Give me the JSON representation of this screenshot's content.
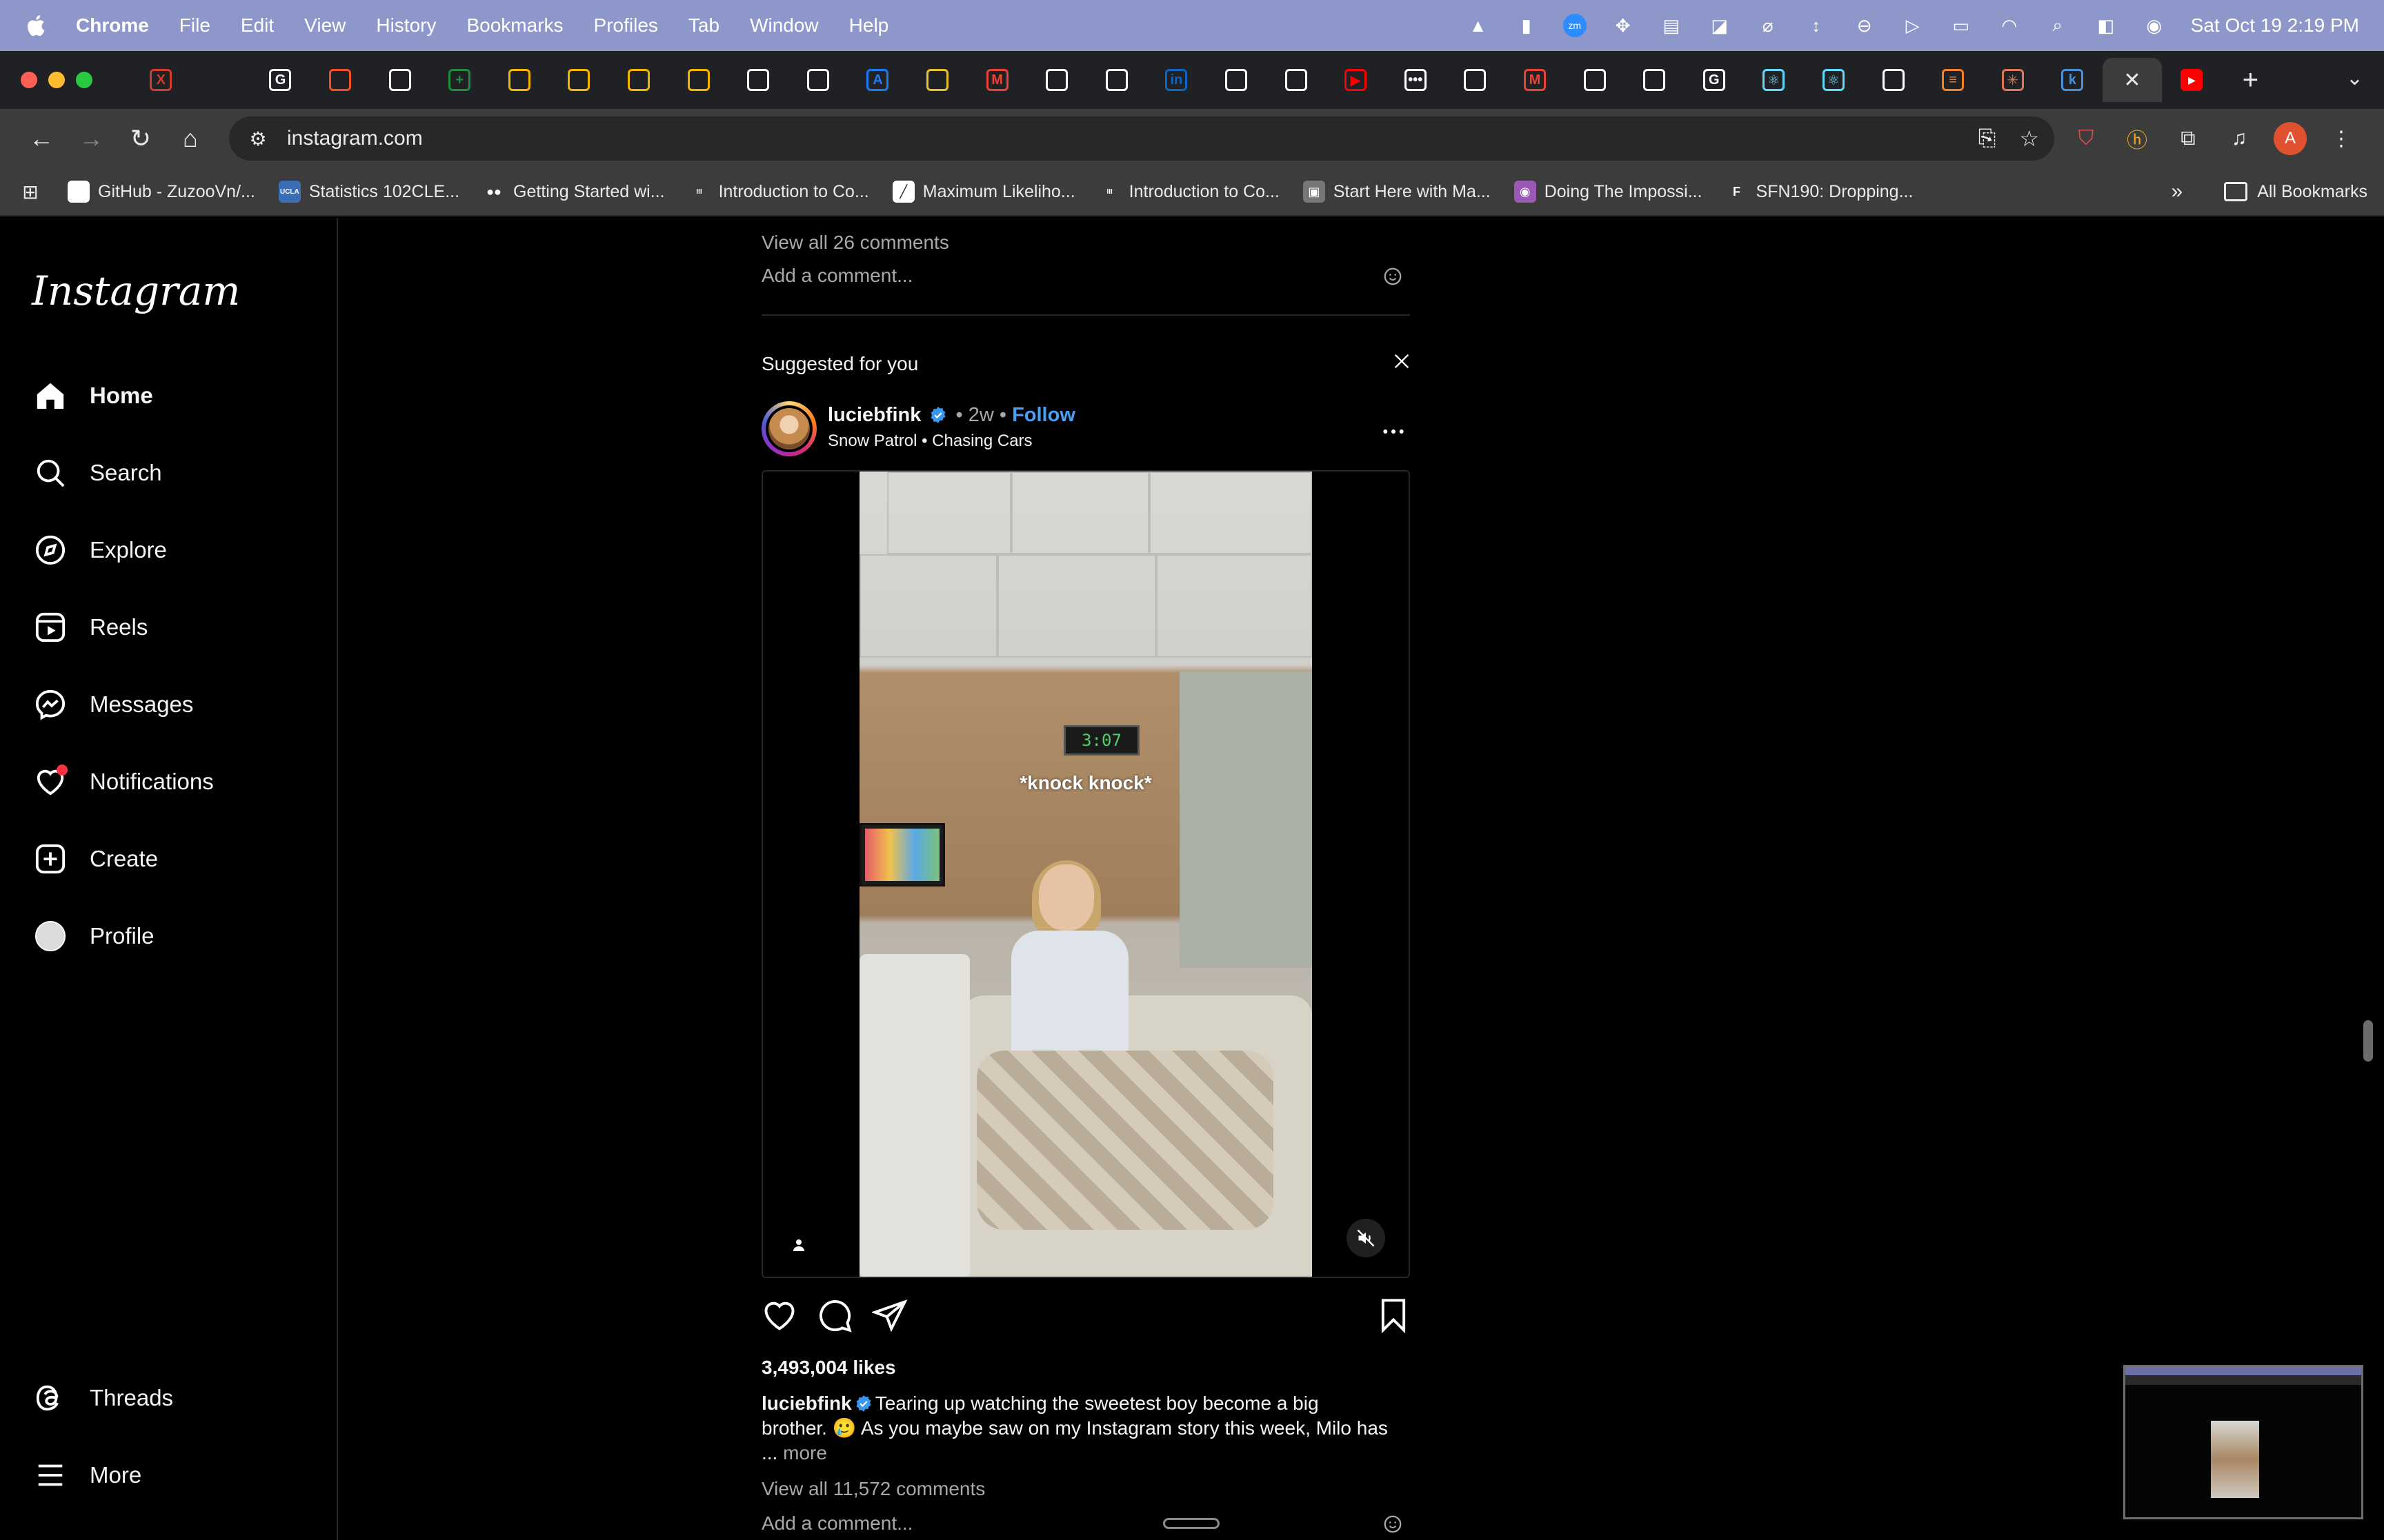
{
  "menubar": {
    "app_name": "Chrome",
    "items": [
      "File",
      "Edit",
      "View",
      "History",
      "Bookmarks",
      "Profiles",
      "Tab",
      "Window",
      "Help"
    ],
    "clock": "Sat Oct 19  2:19 PM",
    "bg_color": "#8e97c9"
  },
  "tabs": {
    "favicons": [
      {
        "icon": "x-tab-icon",
        "label": "X",
        "color": "#d33b2e"
      },
      {
        "icon": "openai-icon",
        "label": "✺",
        "color": "#202124"
      },
      {
        "icon": "google-icon",
        "label": "G",
        "color": "#ffffff"
      },
      {
        "icon": "microsoft-icon",
        "label": "",
        "color": "#f25022"
      },
      {
        "icon": "github-icon",
        "label": "",
        "color": "#ffffff"
      },
      {
        "icon": "sheets-icon",
        "label": "+",
        "color": "#1e8e3e"
      },
      {
        "icon": "slides-icon",
        "label": "",
        "color": "#f4b400"
      },
      {
        "icon": "slides-icon",
        "label": "",
        "color": "#f4b400"
      },
      {
        "icon": "slides-icon",
        "label": "",
        "color": "#f4b400"
      },
      {
        "icon": "slides-icon",
        "label": "",
        "color": "#f4b400"
      },
      {
        "icon": "github-icon",
        "label": "",
        "color": "#ffffff"
      },
      {
        "icon": "github-icon",
        "label": "",
        "color": "#ffffff"
      },
      {
        "icon": "appstore-icon",
        "label": "A",
        "color": "#1b7cf3"
      },
      {
        "icon": "shield-badge-icon",
        "label": "",
        "color": "#e7c02a"
      },
      {
        "icon": "gmail-icon",
        "label": "M",
        "color": "#ea4335"
      },
      {
        "icon": "github-icon",
        "label": "",
        "color": "#ffffff"
      },
      {
        "icon": "chrome-icon",
        "label": "",
        "color": "#ffffff"
      },
      {
        "icon": "linkedin-icon",
        "label": "in",
        "color": "#0a66c2"
      },
      {
        "icon": "chrome-icon",
        "label": "",
        "color": "#ffffff"
      },
      {
        "icon": "github-icon",
        "label": "",
        "color": "#ffffff"
      },
      {
        "icon": "youtube-icon",
        "label": "▶",
        "color": "#ff0000"
      },
      {
        "icon": "dots-icon",
        "label": "•••",
        "color": "#ffffff"
      },
      {
        "icon": "github-icon",
        "label": "",
        "color": "#ffffff"
      },
      {
        "icon": "gmail-icon",
        "label": "M",
        "color": "#ea4335"
      },
      {
        "icon": "github-icon",
        "label": "",
        "color": "#ffffff"
      },
      {
        "icon": "github-icon",
        "label": "",
        "color": "#ffffff"
      },
      {
        "icon": "google-icon",
        "label": "G",
        "color": "#ffffff"
      },
      {
        "icon": "react-icon",
        "label": "⚛",
        "color": "#61dafb"
      },
      {
        "icon": "react-icon",
        "label": "⚛",
        "color": "#61dafb"
      },
      {
        "icon": "github-icon",
        "label": "",
        "color": "#ffffff"
      },
      {
        "icon": "stack-icon",
        "label": "≡",
        "color": "#f48024"
      },
      {
        "icon": "claude-icon",
        "label": "✳",
        "color": "#d97757"
      },
      {
        "icon": "k-icon",
        "label": "k",
        "color": "#4a90d9"
      }
    ],
    "active_close": "✕",
    "after_active": {
      "icon": "youtube-icon",
      "label": "▶",
      "color": "#ff0000"
    },
    "new_tab": "+"
  },
  "toolbar": {
    "url": "instagram.com",
    "profile_initial": "A"
  },
  "bookmarks": {
    "items": [
      {
        "label": "GitHub - ZuzooVn/...",
        "icon": "github-icon",
        "glyph": "",
        "color": "#ffffff"
      },
      {
        "label": "Statistics 102CLE...",
        "icon": "ucla-icon",
        "glyph": "UCLA",
        "color": "#3a6fb7"
      },
      {
        "label": "Getting Started wi...",
        "icon": "medium-icon",
        "glyph": "●●",
        "color": "#3c3c3c"
      },
      {
        "label": "Introduction to Co...",
        "icon": "course-icon",
        "glyph": "III",
        "color": "#3c3c3c"
      },
      {
        "label": "Maximum Likeliho...",
        "icon": "chart-doc-icon",
        "glyph": "╱",
        "color": "#ffffff"
      },
      {
        "label": "Introduction to Co...",
        "icon": "course-icon",
        "glyph": "III",
        "color": "#3c3c3c"
      },
      {
        "label": "Start Here with Ma...",
        "icon": "image-icon",
        "glyph": "▣",
        "color": "#777777"
      },
      {
        "label": "Doing The Impossi...",
        "icon": "circle-logo-icon",
        "glyph": "◉",
        "color": "#9b59b6"
      },
      {
        "label": "SFN190: Dropping...",
        "icon": "f-icon",
        "glyph": "F",
        "color": "#3c3c3c"
      }
    ],
    "more": "»",
    "all_bookmarks": "All Bookmarks"
  },
  "sidebar": {
    "logo": "Instagram",
    "items": [
      {
        "label": "Home",
        "icon": "home-icon",
        "bold": true
      },
      {
        "label": "Search",
        "icon": "search-icon"
      },
      {
        "label": "Explore",
        "icon": "compass-icon"
      },
      {
        "label": "Reels",
        "icon": "reels-icon"
      },
      {
        "label": "Messages",
        "icon": "messenger-icon"
      },
      {
        "label": "Notifications",
        "icon": "heart-icon"
      },
      {
        "label": "Create",
        "icon": "plus-square-icon"
      },
      {
        "label": "Profile",
        "icon": "profile-avatar-icon"
      }
    ],
    "bottom": [
      {
        "label": "Threads",
        "icon": "threads-icon"
      },
      {
        "label": "More",
        "icon": "hamburger-icon"
      }
    ]
  },
  "feed": {
    "prev_post": {
      "view_comments": "View all 26 comments",
      "add_comment_placeholder": "Add a comment..."
    },
    "suggested": {
      "heading": "Suggested for you",
      "username": "luciebfink",
      "time": "2w",
      "follow": "Follow",
      "music": "Snow Patrol",
      "song": "Chasing Cars",
      "video_caption": "*knock knock*",
      "clock_display": "3:07",
      "likes": "3,493,004 likes",
      "caption_user": "luciebfink",
      "caption_line1": "Tearing up watching the sweetest boy become a big",
      "caption_line2": "brother. 🥲 As you maybe saw on my Instagram story this week, Milo has",
      "caption_more_prefix": "...",
      "caption_more": "more",
      "view_comments": "View all 11,572 comments",
      "add_comment_placeholder": "Add a comment..."
    }
  },
  "colors": {
    "link_blue": "#4a9ff5",
    "notification_red": "#ff3040",
    "muted_text": "#a8a8a8"
  }
}
